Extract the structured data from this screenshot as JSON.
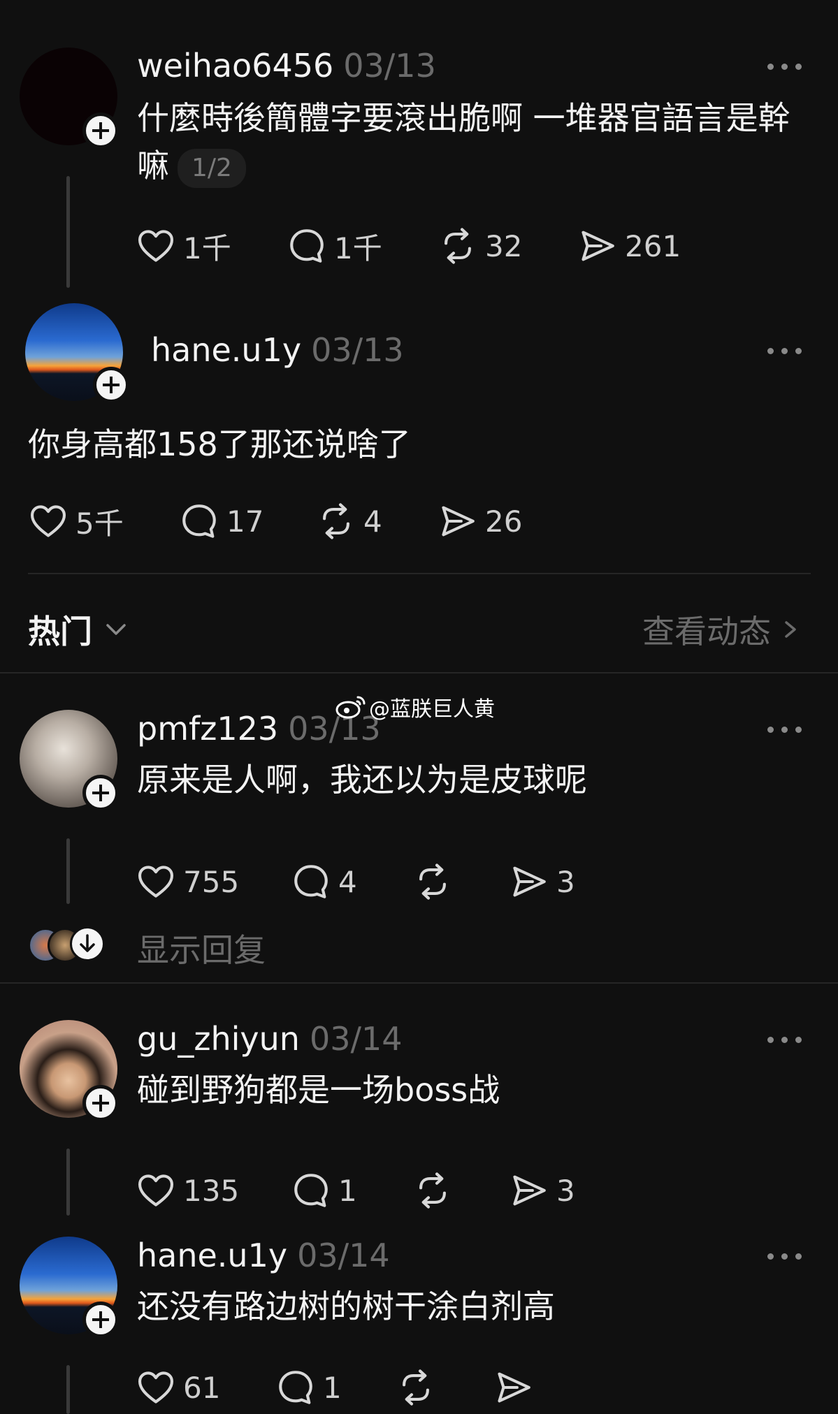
{
  "posts": [
    {
      "username": "weihao6456",
      "date": "03/13",
      "text": "什麼時後簡體字要滾出脆啊  一堆器官語言是幹嘛",
      "pager": "1/2",
      "likes": "1千",
      "comments": "1千",
      "reposts": "32",
      "shares": "261"
    },
    {
      "username": "hane.u1y",
      "date": "03/13",
      "text": "你身高都158了那还说啥了",
      "likes": "5千",
      "comments": "17",
      "reposts": "4",
      "shares": "26"
    }
  ],
  "section": {
    "sort_label": "热门",
    "view_activity": "查看动态"
  },
  "watermark": "@蓝朕巨人黄",
  "replies": [
    {
      "username": "pmfz123",
      "date": "03/13",
      "text": "原来是人啊，我还以为是皮球呢",
      "likes": "755",
      "comments": "4",
      "reposts": "",
      "shares": "3",
      "show_replies": "显示回复"
    },
    {
      "username": "gu_zhiyun",
      "date": "03/14",
      "text": "碰到野狗都是一场boss战",
      "likes": "135",
      "comments": "1",
      "reposts": "",
      "shares": "3"
    },
    {
      "username": "hane.u1y",
      "date": "03/14",
      "text": "还没有路边树的树干涂白剂高",
      "likes": "61",
      "comments": "1",
      "reposts": "",
      "shares": ""
    }
  ],
  "icons": {
    "like": "heart-icon",
    "comment": "comment-bubble-icon",
    "repost": "repost-icon",
    "share": "send-icon",
    "more": "more-horizontal-icon",
    "follow": "plus-icon",
    "sort": "chevron-down-icon",
    "view_more": "chevron-right-icon",
    "expand": "arrow-down-icon"
  },
  "colors": {
    "background": "#101010",
    "text": "#f3f3f3",
    "muted": "#6b6b6b"
  }
}
